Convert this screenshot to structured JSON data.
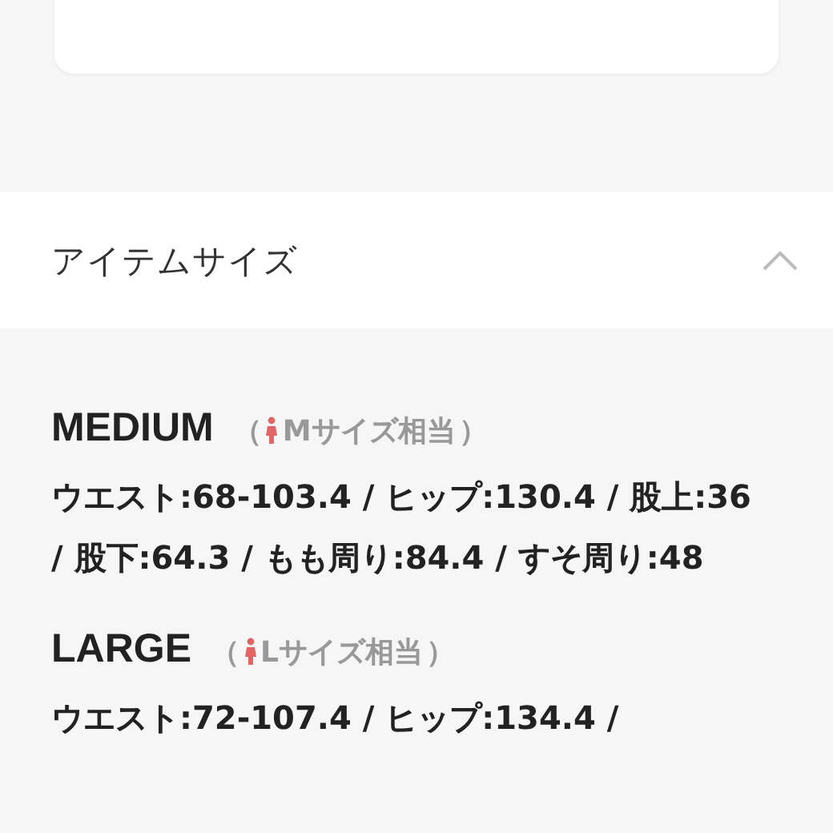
{
  "section": {
    "title": "アイテムサイズ",
    "expanded": true
  },
  "sizes": [
    {
      "name": "MEDIUM",
      "paren_open": "（",
      "note": "Mサイズ相当",
      "paren_close": "）",
      "measurements": "ウエスト:68-103.4 / ヒップ:130.4 / 股上:36 / 股下:64.3 / もも周り:84.4 / すそ周り:48"
    },
    {
      "name": "LARGE",
      "paren_open": "（",
      "note": "Lサイズ相当",
      "paren_close": "）",
      "measurements": "ウエスト:72-107.4 / ヒップ:134.4 /"
    }
  ]
}
